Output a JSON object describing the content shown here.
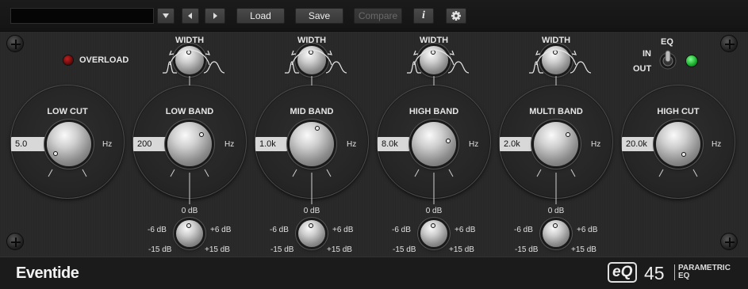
{
  "toolbar": {
    "preset_name": "",
    "load_label": "Load",
    "save_label": "Save",
    "compare_label": "Compare",
    "info_label": "i"
  },
  "overload_label": "OVERLOAD",
  "eq_switch": {
    "title": "EQ",
    "in_label": "IN",
    "out_label": "OUT"
  },
  "width_label": "WIDTH",
  "unit_hz": "Hz",
  "low_cut": {
    "label": "LOW CUT",
    "value": "5.0"
  },
  "high_cut": {
    "label": "HIGH CUT",
    "value": "20.0k"
  },
  "bands": [
    {
      "label": "LOW BAND",
      "freq": "200"
    },
    {
      "label": "MID BAND",
      "freq": "1.0k"
    },
    {
      "label": "HIGH BAND",
      "freq": "8.0k"
    },
    {
      "label": "MULTI BAND",
      "freq": "2.0k"
    }
  ],
  "gain_labels": {
    "center": "0 dB",
    "minus6": "-6 dB",
    "plus6": "+6 dB",
    "minus15": "-15 dB",
    "plus15": "+15 dB"
  },
  "brand": {
    "logo": "Eventide",
    "product_eq": "eQ",
    "product_num": "45",
    "product_line1": "PARAMETRIC",
    "product_line2": "EQ"
  },
  "colors": {
    "overload_led": "#7a1010",
    "eq_led": "#22c43a",
    "value_box": "#d8d8d8"
  }
}
